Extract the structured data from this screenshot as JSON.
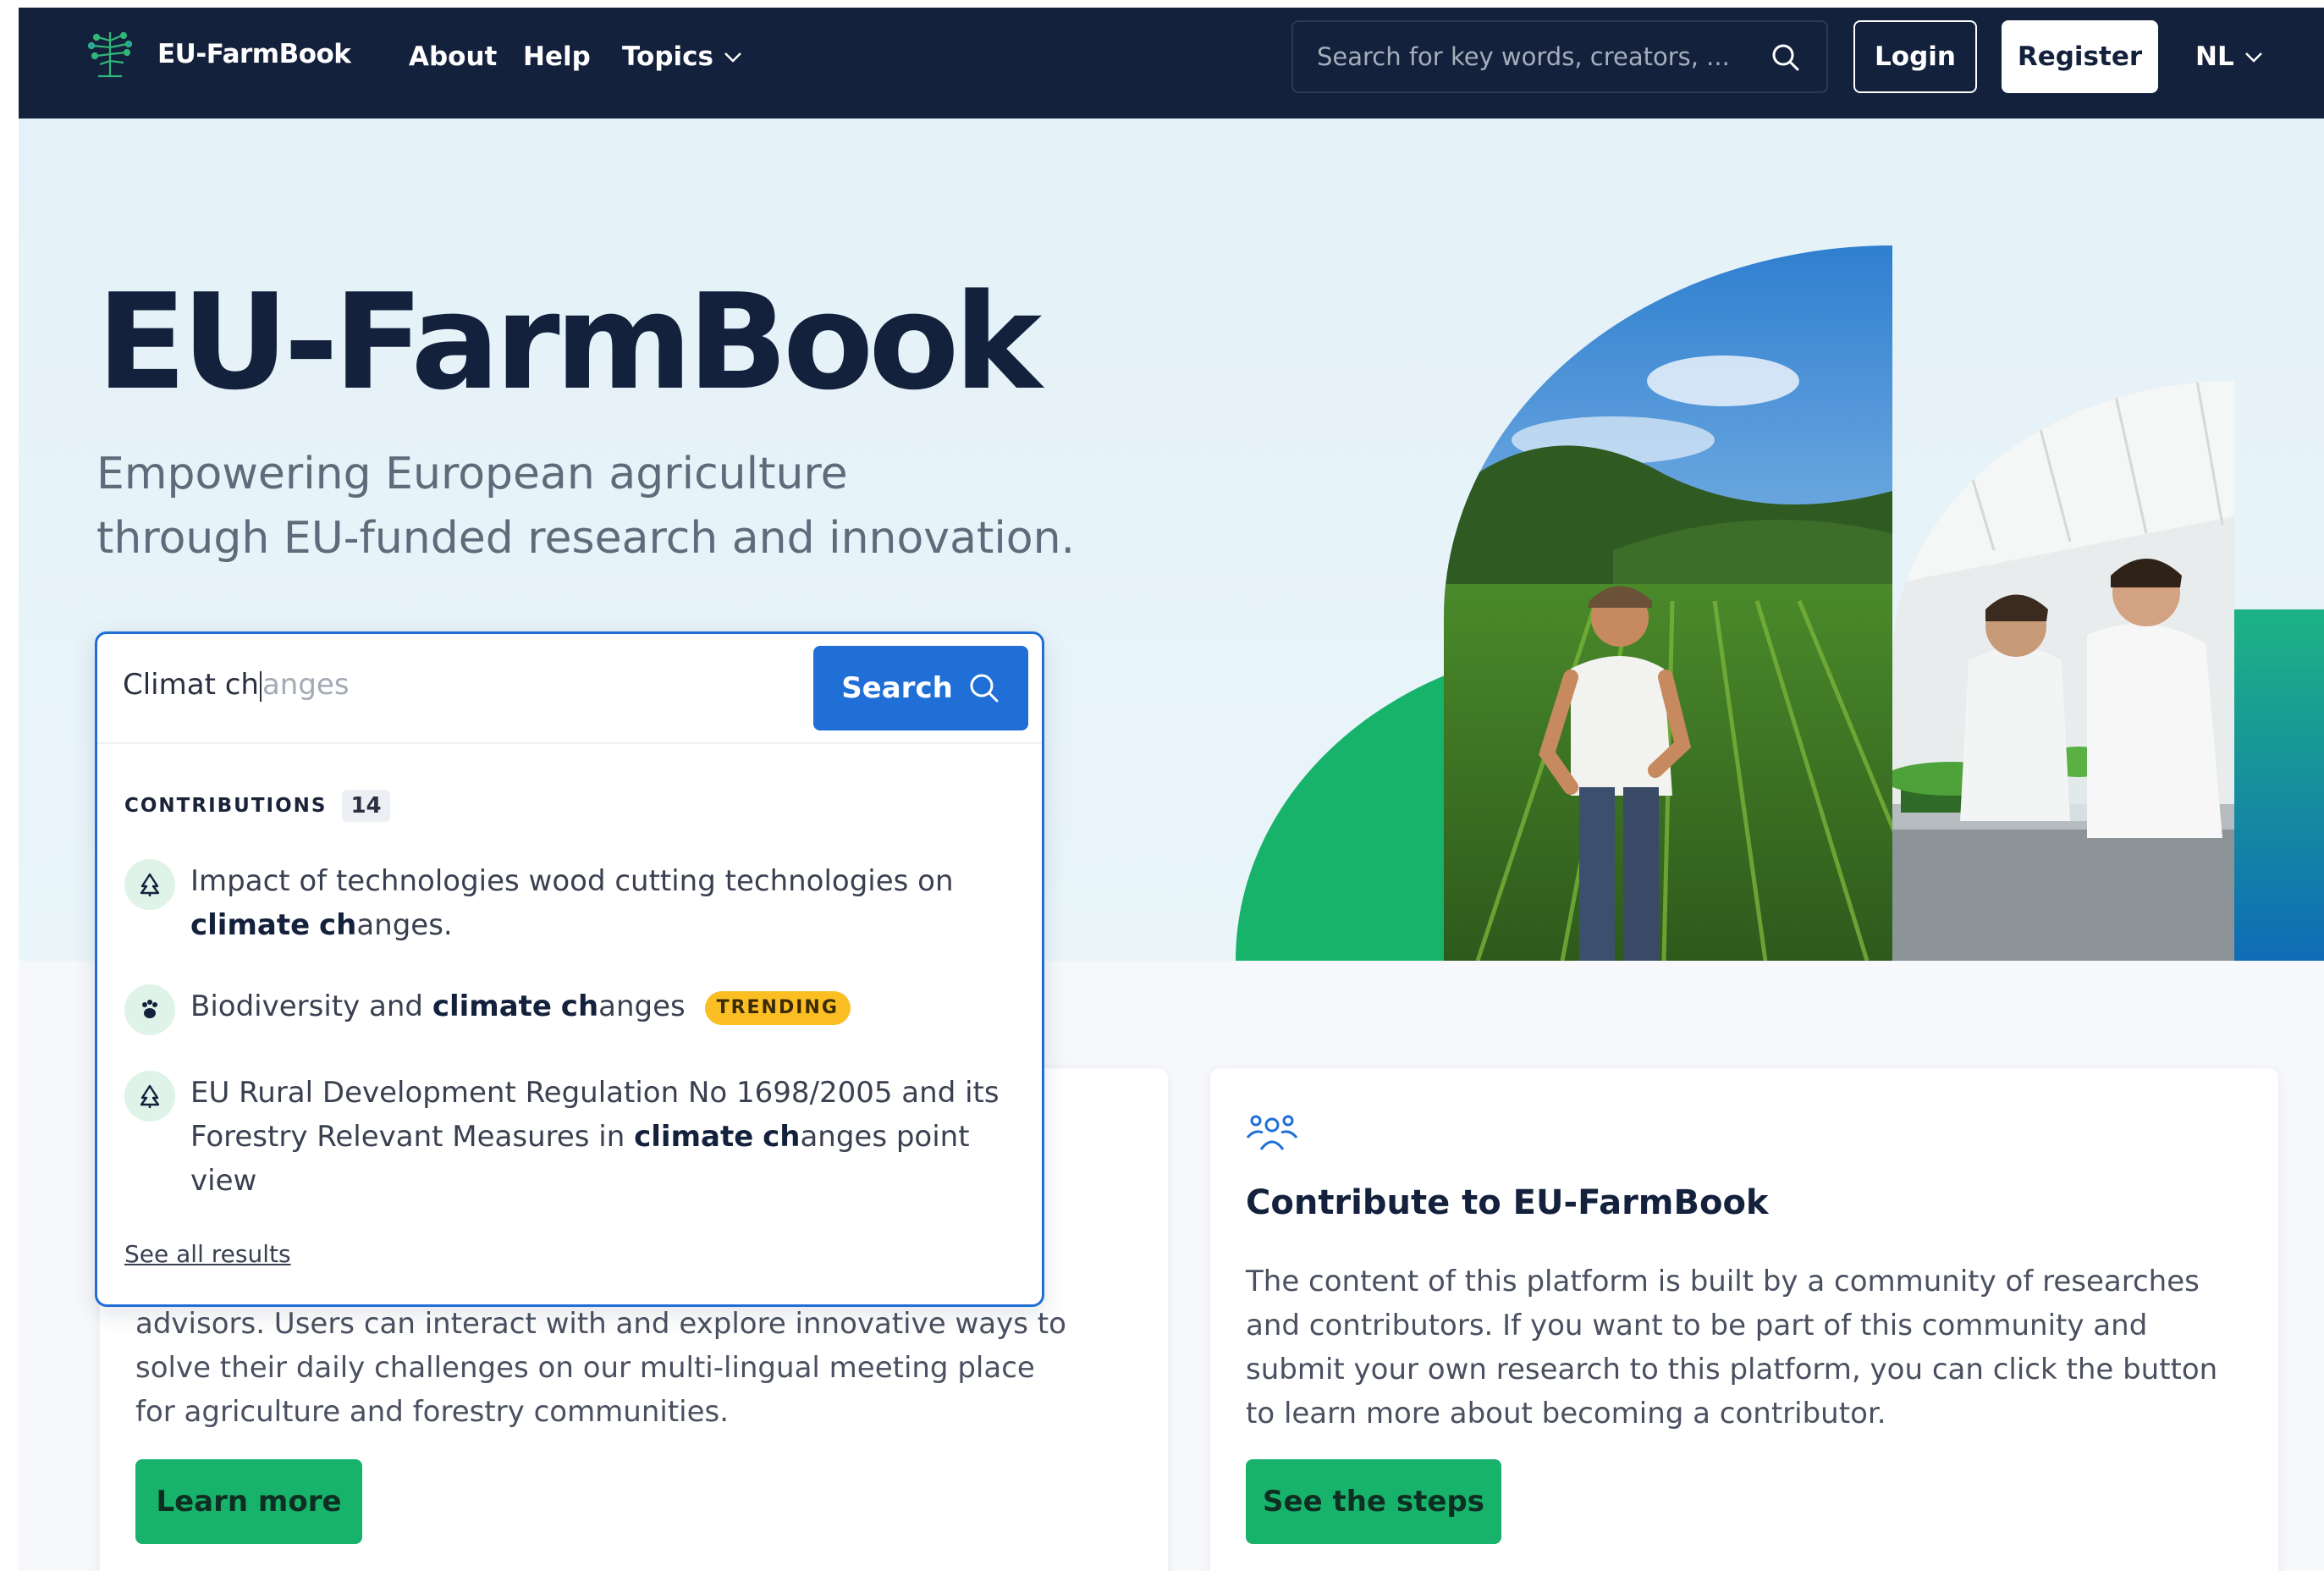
{
  "nav": {
    "brand": "EU-FarmBook",
    "links": [
      "About",
      "Help",
      "Topics"
    ],
    "search_placeholder": "Search for key words, creators, ...",
    "login": "Login",
    "register": "Register",
    "language": "NL"
  },
  "hero": {
    "title": "EU-FarmBook",
    "subtitle_line1": "Empowering European agriculture",
    "subtitle_line2": "through EU-funded research and innovation."
  },
  "search": {
    "typed": "Climat ch",
    "ghost": "anges",
    "button": "Search",
    "section_label": "CONTRIBUTIONS",
    "count": "14",
    "results": [
      {
        "icon": "tree-icon",
        "pre": "Impact of technologies wood cutting technologies on",
        "bold1": "climate",
        "bold2": "ch",
        "post": "anges."
      },
      {
        "icon": "paw-icon",
        "pre": "Biodiversity and",
        "bold1": "climate",
        "bold2": "ch",
        "post": "anges",
        "badge": "TRENDING"
      },
      {
        "icon": "tree-icon",
        "pre": "EU Rural Development Regulation No 1698/2005 and its Forestry Relevant Measures in",
        "bold1": "climate",
        "bold2": "ch",
        "post": "anges point view"
      }
    ],
    "see_all": "See all results"
  },
  "cards": {
    "left": {
      "text": "advisors. Users can interact with and explore innovative ways to solve their daily challenges on our multi-lingual meeting place for agriculture and forestry communities.",
      "button": "Learn more"
    },
    "right": {
      "icon": "community-icon",
      "title": "Contribute to EU-FarmBook",
      "text": "The content of this platform is built by a community of researches and contributors. If you want to be part of this community and submit your own research to this platform, you can click the button to learn more about becoming a contributor.",
      "button": "See the steps"
    }
  },
  "colors": {
    "nav_bg": "#14213d",
    "primary_blue": "#1f6fd6",
    "accent_green": "#17b36b",
    "trending_yellow": "#fbbf24"
  }
}
